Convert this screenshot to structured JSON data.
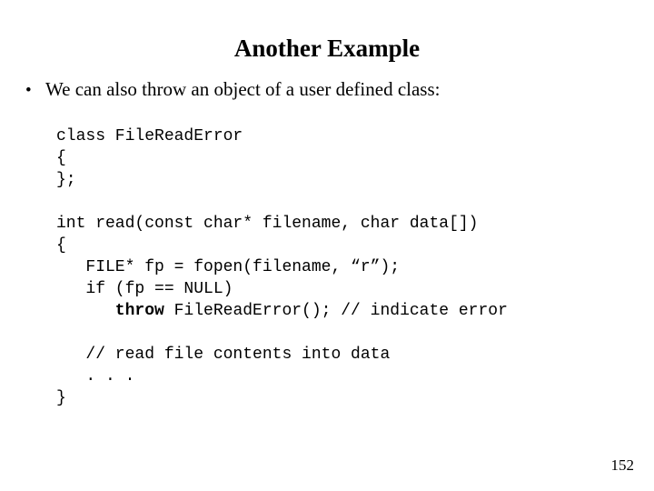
{
  "slide": {
    "title": "Another Example",
    "page_number": "152",
    "background_color": "#ffffff",
    "text_color": "#000000"
  },
  "bullet": {
    "marker": "•",
    "text": "We can also throw an object of a user defined class:"
  },
  "code": {
    "lines": [
      {
        "id": "line-1",
        "text": "class FileReadError",
        "blank": false,
        "bold_prefix": ""
      },
      {
        "id": "line-2",
        "text": "{",
        "blank": false,
        "bold_prefix": ""
      },
      {
        "id": "line-3",
        "text": "};",
        "blank": false,
        "bold_prefix": ""
      },
      {
        "id": "line-4",
        "text": "",
        "blank": true,
        "bold_prefix": ""
      },
      {
        "id": "line-5",
        "text": "int read(const char* filename, char data[])",
        "blank": false,
        "bold_prefix": ""
      },
      {
        "id": "line-6",
        "text": "{",
        "blank": false,
        "bold_prefix": ""
      },
      {
        "id": "line-7",
        "text": "   FILE* fp = fopen(filename, “r”);",
        "blank": false,
        "bold_prefix": ""
      },
      {
        "id": "line-8",
        "text": "   if (fp == NULL)",
        "blank": false,
        "bold_prefix": ""
      },
      {
        "id": "line-9",
        "text": " FileReadError(); // indicate error",
        "blank": false,
        "bold_prefix": "      throw"
      },
      {
        "id": "line-10",
        "text": "",
        "blank": true,
        "bold_prefix": ""
      },
      {
        "id": "line-11",
        "text": "   // read file contents into data",
        "blank": false,
        "bold_prefix": ""
      },
      {
        "id": "line-12",
        "text": "   . . .",
        "blank": false,
        "bold_prefix": ""
      },
      {
        "id": "line-13",
        "text": "}",
        "blank": false,
        "bold_prefix": ""
      }
    ]
  }
}
